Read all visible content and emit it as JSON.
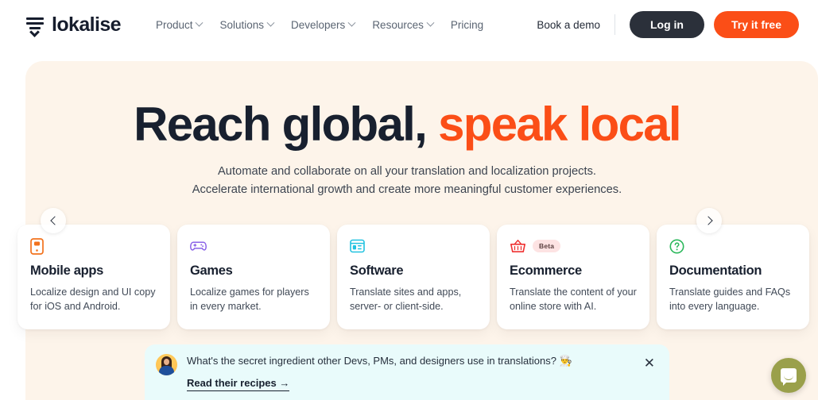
{
  "header": {
    "logo_text": "lokalise",
    "logo_icon": "lokalise-stack-chevron-logo",
    "nav": [
      {
        "label": "Product",
        "has_caret": true
      },
      {
        "label": "Solutions",
        "has_caret": true
      },
      {
        "label": "Developers",
        "has_caret": true
      },
      {
        "label": "Resources",
        "has_caret": true
      },
      {
        "label": "Pricing",
        "has_caret": false
      }
    ],
    "book_demo_label": "Book a demo",
    "login_label": "Log in",
    "try_free_label": "Try it free",
    "login_bg": "#2b303a",
    "try_free_bg": "#fb4e17"
  },
  "hero": {
    "title_main": "Reach global,",
    "title_accent": "speak local",
    "subtitle_line1": "Automate and collaborate on all your translation and localization projects.",
    "subtitle_line2": "Accelerate international growth and create more meaningful customer experiences.",
    "background": "#fdf4ea",
    "accent_color": "#fb4e17"
  },
  "carousel": {
    "prev_label": "‹",
    "next_label": "›",
    "cards": [
      {
        "icon": "mobile-phone-icon",
        "icon_color": "#f2721d",
        "title": "Mobile apps",
        "desc": "Localize design and UI copy for iOS and Android.",
        "badge": null
      },
      {
        "icon": "gamepad-icon",
        "icon_color": "#8b63e8",
        "title": "Games",
        "desc": "Localize games for players in every market.",
        "badge": null
      },
      {
        "icon": "browser-window-icon",
        "icon_color": "#21c2e0",
        "title": "Software",
        "desc": "Translate sites and apps, server- or client-side.",
        "badge": null
      },
      {
        "icon": "shopping-basket-icon",
        "icon_color": "#ef3232",
        "title": "Ecommerce",
        "desc": "Translate the content of your online store with AI.",
        "badge": "Beta"
      },
      {
        "icon": "question-circle-icon",
        "icon_color": "#2cb85c",
        "title": "Documentation",
        "desc": "Translate guides and FAQs into every language.",
        "badge": null
      }
    ]
  },
  "banner": {
    "avatar_icon": "person-avatar",
    "text": "What's the secret ingredient other Devs, PMs, and designers use in translations? 👨‍🍳",
    "link_label": "Read their recipes →",
    "close_icon": "close-icon",
    "close_label": "✕",
    "background": "#e9fbfb"
  },
  "chat": {
    "icon": "chat-bubble-icon",
    "background": "#9aa04b"
  }
}
